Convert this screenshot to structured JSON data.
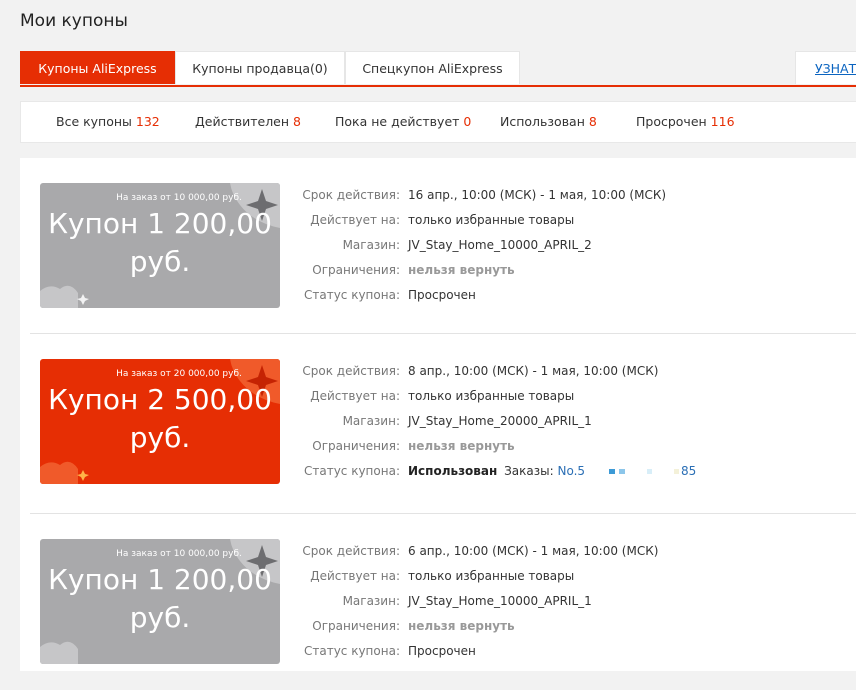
{
  "page_title": "Мои купоны",
  "tabs": [
    {
      "label": "Купоны AliExpress",
      "active": true
    },
    {
      "label": "Купоны продавца(0)",
      "active": false
    },
    {
      "label": "Спецкупон AliExpress",
      "active": false
    }
  ],
  "learn_link": "УЗНАТЬ",
  "filters": [
    {
      "label": "Все купоны",
      "count": "132"
    },
    {
      "label": "Действителен",
      "count": "8"
    },
    {
      "label": "Пока не действует",
      "count": "0"
    },
    {
      "label": "Использован",
      "count": "8"
    },
    {
      "label": "Просрочен",
      "count": "116"
    }
  ],
  "labels": {
    "validity": "Срок действия:",
    "applies": "Действует на:",
    "store": "Магазин:",
    "restrictions": "Ограничения:",
    "status": "Статус купона:"
  },
  "coupons": [
    {
      "color": "gray",
      "min_order": "На заказ от 10 000,00 руб.",
      "amount_line1": "Купон 1 200,00",
      "amount_line2": "руб.",
      "validity": "16 апр., 10:00 (МСК) - 1 мая, 10:00 (МСК)",
      "applies": "только избранные товары",
      "store": "JV_Stay_Home_10000_APRIL_2",
      "restrictions": "нельзя вернуть",
      "status": "Просрочен"
    },
    {
      "color": "red",
      "min_order": "На заказ от 20 000,00 руб.",
      "amount_line1": "Купон 2 500,00",
      "amount_line2": "руб.",
      "validity": "8 апр., 10:00 (МСК) - 1 мая, 10:00 (МСК)",
      "applies": "только избранные товары",
      "store": "JV_Stay_Home_20000_APRIL_1",
      "restrictions": "нельзя вернуть",
      "status": "Использован",
      "orders_label": "Заказы:",
      "order_prefix": "No.5",
      "order_suffix": "85"
    },
    {
      "color": "gray",
      "min_order": "На заказ от 10 000,00 руб.",
      "amount_line1": "Купон 1 200,00",
      "amount_line2": "руб.",
      "validity": "6 апр., 10:00 (МСК) - 1 мая, 10:00 (МСК)",
      "applies": "только избранные товары",
      "store": "JV_Stay_Home_10000_APRIL_1",
      "restrictions": "нельзя вернуть",
      "status": "Просрочен"
    }
  ],
  "colors": {
    "accent": "#e62e04",
    "card_gray": "#a9a9ab",
    "link": "#2b6fb5",
    "count": "#e62e04"
  }
}
